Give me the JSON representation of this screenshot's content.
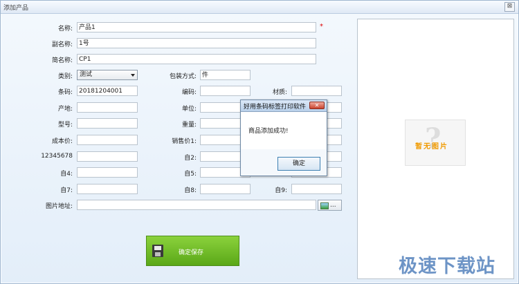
{
  "window": {
    "title": "添加产品",
    "close_glyph": "⊠"
  },
  "form": {
    "name": {
      "label": "名称:",
      "value": "产品1",
      "required": "*"
    },
    "alias": {
      "label": "副名称:",
      "value": "1号"
    },
    "short_name": {
      "label": "简名称:",
      "value": "CP1"
    },
    "category": {
      "label": "类别:",
      "value": "测试"
    },
    "packaging": {
      "label": "包装方式:",
      "value": "件"
    },
    "barcode": {
      "label": "条码:",
      "value": "20181204001"
    },
    "code": {
      "label": "编码:",
      "value": ""
    },
    "material": {
      "label": "材质:",
      "value": ""
    },
    "origin": {
      "label": "产地:",
      "value": ""
    },
    "unit": {
      "label": "单位:",
      "value": ""
    },
    "model": {
      "label": "型号:",
      "value": ""
    },
    "weight": {
      "label": "重量:",
      "value": ""
    },
    "cost_price": {
      "label": "成本价:",
      "value": ""
    },
    "sale_price": {
      "label": "销售价1:",
      "value": ""
    },
    "custom1": {
      "label": "12345678",
      "value": ""
    },
    "custom2": {
      "label": "自2:",
      "value": ""
    },
    "custom4": {
      "label": "自4:",
      "value": ""
    },
    "custom5": {
      "label": "自5:",
      "value": ""
    },
    "custom7": {
      "label": "自7:",
      "value": ""
    },
    "custom8": {
      "label": "自8:",
      "value": ""
    },
    "custom9": {
      "label": "自9:",
      "value": ""
    },
    "image_path": {
      "label": "图片地址:",
      "value": "",
      "browse_dots": "..."
    }
  },
  "image_panel": {
    "placeholder_mark": "?",
    "placeholder_text": "暂无图片"
  },
  "save_button": {
    "label": "确定保存"
  },
  "dialog": {
    "title": "好用条码标签打印软件",
    "close_glyph": "✕",
    "message": "商品添加成功!",
    "ok_label": "确定"
  },
  "watermark": "极速下载站"
}
